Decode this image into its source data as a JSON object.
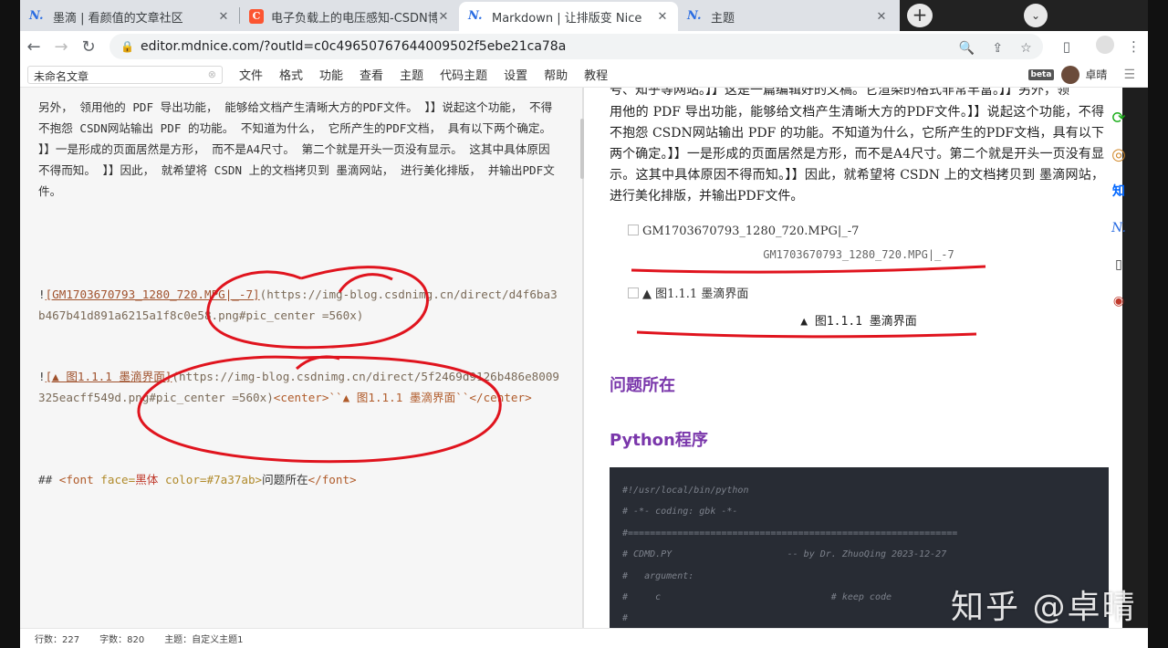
{
  "browser": {
    "tabs": [
      {
        "icon": "mdnice-icon",
        "label": "墨滴 | 看颜值的文章社区",
        "active": false
      },
      {
        "icon": "csdn-icon",
        "label": "电子负载上的电压感知-CSDN博客",
        "active": false
      },
      {
        "icon": "mdnice-icon",
        "label": "Markdown | 让排版变 Nice",
        "active": true
      },
      {
        "icon": "mdnice-icon",
        "label": "主题",
        "active": false
      }
    ],
    "url": "editor.mdnice.com/?outId=c0c49650767644009502f5ebe21ca78a"
  },
  "menubar": {
    "doc_title": "未命名文章",
    "items": [
      "文件",
      "格式",
      "功能",
      "查看",
      "主题",
      "代码主题",
      "设置",
      "帮助",
      "教程"
    ],
    "beta": "beta",
    "user": "卓晴"
  },
  "editor": {
    "para1": "另外， 领用他的 PDF 导出功能， 能够给文档产生清晰大方的PDF文件。 】】说起这个功能， 不得不抱怨 CSDN网站输出 PDF 的功能。 不知道为什么， 它所产生的PDF文档， 具有以下两个确定。 】】一是形成的页面居然是方形， 而不是A4尺寸。 第二个就是开头一页没有显示。 这其中具体原因不得而知。 】】因此， 就希望将 CSDN 上的文档拷贝到 墨滴网站， 进行美化排版， 并输出PDF文件。",
    "img1_prefix": "!",
    "img1_link": "[GM1703670793_1280_720.MPG|_-7]",
    "img1_url": "(https://img-blog.csdnimg.cn/direct/d4f6ba3b467b41d891a6215a1f8c0e58.png#pic_center =560x)",
    "img2_prefix": "!",
    "img2_link": "[▲ 图1.1.1 墨滴界面]",
    "img2_url": "(https://img-blog.csdnimg.cn/direct/5f2469d9126b486e8009325eacff549d.png#pic_center =560x)",
    "img2_tail": "<center>``▲ 图1.1.1 墨滴界面``</center>",
    "h2_hash": "##",
    "h2_font_open": "<font",
    "h2_face_attr": "face=",
    "h2_face_val": "黑体",
    "h2_color_attr": "color=",
    "h2_color_val": "#7a37ab>",
    "h2_text": "问题所在",
    "h2_font_close": "</font>"
  },
  "status": {
    "lines": "行数：227",
    "chars": "字数：820",
    "theme": "主题：自定义主题1"
  },
  "preview": {
    "top_partial": "号、知乎等网站。】】这是一篇编辑好的文稿。它渲染的格式非常丰富。】】另外，领",
    "para1": "用他的 PDF 导出功能，能够给文档产生清晰大方的PDF文件。】】说起这个功能，不得不抱怨 CSDN网站输出 PDF 的功能。不知道为什么，它所产生的PDF文档，具有以下两个确定。】】一是形成的页面居然是方形，而不是A4尺寸。第二个就是开头一页没有显示。这其中具体原因不得而知。】】因此，就希望将 CSDN 上的文档拷贝到 墨滴网站，进行美化排版，并输出PDF文件。",
    "img1_alt": "GM1703670793_1280_720.MPG|_-7",
    "img1_caption": "GM1703670793_1280_720.MPG|_-7",
    "img2_alt": "▲ 图1.1.1 墨滴界面",
    "img2_caption": "▲ 图1.1.1 墨滴界面",
    "h_problem": "问题所在",
    "h_python": "Python程序",
    "code_lines": [
      "#!/usr/local/bin/python",
      "# -*- coding: gbk -*-",
      "#============================================================",
      "# CDMD.PY                     -- by Dr. ZhuoQing 2023-12-27",
      "#   argument:",
      "#     c                               # keep code",
      "#"
    ]
  },
  "side_icons": [
    "sync-icon",
    "theme-icon",
    "zhihu-icon",
    "mdnice-icon",
    "mobile-icon",
    "chrome-icon"
  ],
  "watermark": "知乎 @卓晴",
  "colors": {
    "accent_purple": "#7a37ab",
    "annotation_red": "#e0141e",
    "code_bg": "#282c34"
  }
}
